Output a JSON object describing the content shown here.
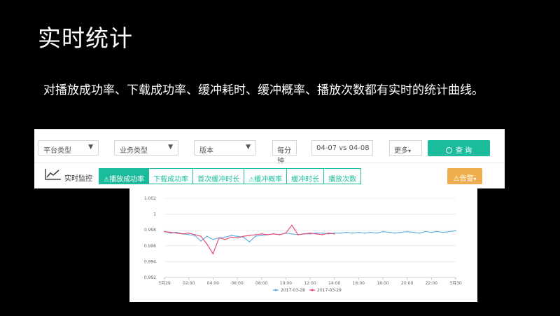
{
  "slide": {
    "title": "实时统计",
    "subtitle": "对播放成功率、下载成功率、缓冲耗时、缓冲概率、播放次数都有实时的统计曲线。"
  },
  "toolbar": {
    "platform_select": "平台类型",
    "business_select": "业务类型",
    "version_select": "版本",
    "interval_select": "每分钟",
    "date_compare": "04-07 vs 04-08",
    "more_button": "更多",
    "query_button": "查 询",
    "search_icon": "search-icon"
  },
  "monitor": {
    "label": "实时监控",
    "icon": "line-chart-icon",
    "tabs": [
      {
        "label": "播放成功率",
        "warning": true,
        "active": true
      },
      {
        "label": "下载成功率",
        "warning": false,
        "active": false
      },
      {
        "label": "首次缓冲时长",
        "warning": false,
        "active": false
      },
      {
        "label": "缓冲概率",
        "warning": true,
        "active": false
      },
      {
        "label": "缓冲时长",
        "warning": false,
        "active": false
      },
      {
        "label": "播放次数",
        "warning": false,
        "active": false
      }
    ],
    "alarm_button": "告警",
    "warning_symbol": "⚠"
  },
  "colors": {
    "accent": "#1abc9c",
    "alarm": "#f0ad4e",
    "series_blue": "#5dade2",
    "series_red": "#e8436b"
  },
  "chart_data": {
    "type": "line",
    "x_tick_labels": [
      "3月29",
      "02:00",
      "04:00",
      "06:00",
      "08:00",
      "10:00",
      "12:00",
      "14:00",
      "16:00",
      "18:00",
      "20:00",
      "22:00",
      "3月30"
    ],
    "y_tick_labels": [
      "0.992",
      "0.994",
      "0.996",
      "0.998",
      "1",
      "1.002"
    ],
    "ylim": [
      0.992,
      1.002
    ],
    "xlim_hours": [
      0,
      24
    ],
    "grid": true,
    "legend_position": "bottom-center",
    "series": [
      {
        "name": "2017-03-28",
        "color": "#5dade2",
        "x": [
          0,
          0.5,
          1,
          1.5,
          2,
          2.5,
          3,
          3.5,
          4,
          4.5,
          5,
          5.5,
          6,
          6.5,
          7,
          7.5,
          8,
          8.5,
          9,
          9.5,
          10,
          10.5,
          11,
          11.5,
          12,
          12.5,
          13,
          13.5,
          14,
          14.5,
          15,
          15.5,
          16,
          16.5,
          17,
          17.5,
          18,
          18.5,
          19,
          19.5,
          20,
          20.5,
          21,
          21.5,
          22,
          22.5,
          23,
          23.5,
          24
        ],
        "values": [
          0.9978,
          0.9976,
          0.9977,
          0.9975,
          0.9974,
          0.9973,
          0.9966,
          0.9972,
          0.9968,
          0.997,
          0.9971,
          0.9973,
          0.9972,
          0.9971,
          0.9965,
          0.9972,
          0.9973,
          0.9974,
          0.9975,
          0.9974,
          0.9976,
          0.9975,
          0.9974,
          0.9975,
          0.9975,
          0.9976,
          0.9976,
          0.9975,
          0.9976,
          0.9976,
          0.9977,
          0.9976,
          0.9977,
          0.9976,
          0.9977,
          0.9976,
          0.9978,
          0.9977,
          0.9976,
          0.9977,
          0.9978,
          0.9977,
          0.9976,
          0.9978,
          0.9977,
          0.9978,
          0.9977,
          0.9978,
          0.9979
        ]
      },
      {
        "name": "2017-03-29",
        "color": "#e8436b",
        "x": [
          0,
          0.5,
          1,
          1.5,
          2,
          2.5,
          3,
          3.5,
          4,
          4.5,
          5,
          5.5,
          6,
          6.5,
          7,
          7.5,
          8,
          8.5,
          9,
          9.5,
          10,
          10.5,
          11,
          11.5,
          12,
          12.5,
          13,
          13.5,
          14
        ],
        "values": [
          0.9978,
          0.9977,
          0.9976,
          0.9975,
          0.9976,
          0.9974,
          0.9972,
          0.9962,
          0.995,
          0.997,
          0.9968,
          0.9971,
          0.997,
          0.9972,
          0.9973,
          0.9974,
          0.9975,
          0.9974,
          0.9975,
          0.9974,
          0.9976,
          0.9986,
          0.9974,
          0.9975,
          0.9976,
          0.9975,
          0.9974,
          0.9976,
          0.9975
        ]
      }
    ]
  }
}
